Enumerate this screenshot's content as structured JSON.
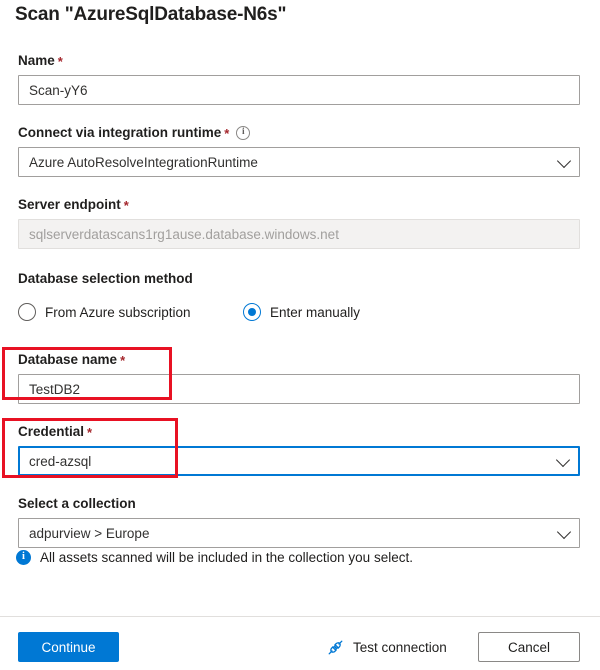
{
  "dialog": {
    "title": "Scan \"AzureSqlDatabase-N6s\"",
    "required_marker": "*"
  },
  "fields": {
    "name": {
      "label": "Name",
      "required": true,
      "value": "Scan-yY6",
      "type": "text"
    },
    "integration_runtime": {
      "label": "Connect via integration runtime",
      "required": true,
      "info_icon": "info-circle-icon",
      "info_glyph": "i",
      "value": "Azure AutoResolveIntegrationRuntime",
      "type": "dropdown"
    },
    "server_endpoint": {
      "label": "Server endpoint",
      "required": true,
      "value": "sqlserverdatascans1rg1ause.database.windows.net",
      "type": "text",
      "disabled": true
    },
    "database_selection_method": {
      "label": "Database selection method",
      "options": [
        {
          "label": "From Azure subscription",
          "selected": false
        },
        {
          "label": "Enter manually",
          "selected": true
        }
      ]
    },
    "database_name": {
      "label": "Database name",
      "required": true,
      "value": "TestDB2",
      "type": "text",
      "highlighted": true
    },
    "credential": {
      "label": "Credential",
      "required": true,
      "value": "cred-azsql",
      "type": "dropdown",
      "focused": true,
      "highlighted": true
    },
    "collection": {
      "label": "Select a collection",
      "required": false,
      "value": "adpurview > Europe",
      "type": "dropdown"
    }
  },
  "hint": {
    "icon": "info-filled-icon",
    "glyph": "i",
    "text": "All assets scanned will be included in the collection you select."
  },
  "footer": {
    "continue_label": "Continue",
    "test_connection_label": "Test connection",
    "test_connection_icon": "plug-connector-icon",
    "cancel_label": "Cancel"
  },
  "colors": {
    "accent": "#0078d4",
    "required_red": "#a4262c",
    "highlight_red": "#e81123",
    "disabled_bg": "#f3f2f1",
    "border": "#a19f9d"
  }
}
